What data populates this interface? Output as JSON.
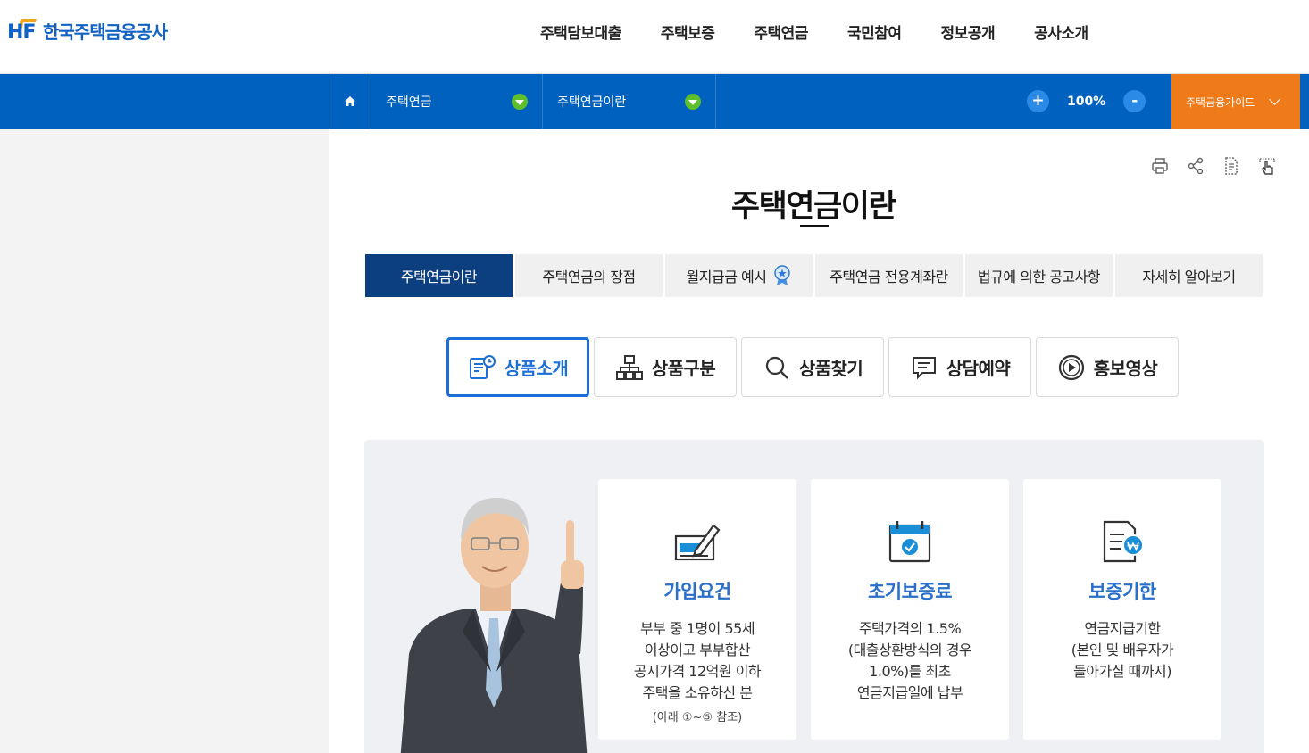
{
  "header": {
    "logo_mark": "HF",
    "logo_text": "한국주택금융공사",
    "nav": [
      "주택담보대출",
      "주택보증",
      "주택연금",
      "국민참여",
      "정보공개",
      "공사소개"
    ]
  },
  "location": {
    "level1": "주택연금",
    "level2": "주택연금이란",
    "zoom": "100%",
    "zoom_in": "+",
    "zoom_out": "-",
    "guide": "주택금융가이드"
  },
  "page": {
    "title": "주택연금이란"
  },
  "tabs": [
    "주택연금이란",
    "주택연금의 장점",
    "월지급금 예시",
    "주택연금 전용계좌란",
    "법규에 의한 공고사항",
    "자세히 알아보기"
  ],
  "subtabs": [
    "상품소개",
    "상품구분",
    "상품찾기",
    "상담예약",
    "홍보영상"
  ],
  "cards": [
    {
      "title": "가입요건",
      "desc": [
        "부부 중 1명이 55세",
        "이상이고 부부합산",
        "공시가격 12억원 이하",
        "주택을 소유하신 분"
      ],
      "note": "(아래 ①~⑤ 참조)"
    },
    {
      "title": "초기보증료",
      "desc": [
        "주택가격의 1.5%",
        "(대출상환방식의 경우",
        "1.0%)를 최초",
        "연금지급일에 납부"
      ]
    },
    {
      "title": "보증기한",
      "desc": [
        "연금지급기한",
        "(본인 및 배우자가",
        "돌아가실 때까지)"
      ]
    }
  ],
  "colors": {
    "brand_blue": "#0061bf",
    "active_tab": "#0c3f7f",
    "guide_orange": "#ef7a1a",
    "card_title": "#2a6fc9"
  }
}
